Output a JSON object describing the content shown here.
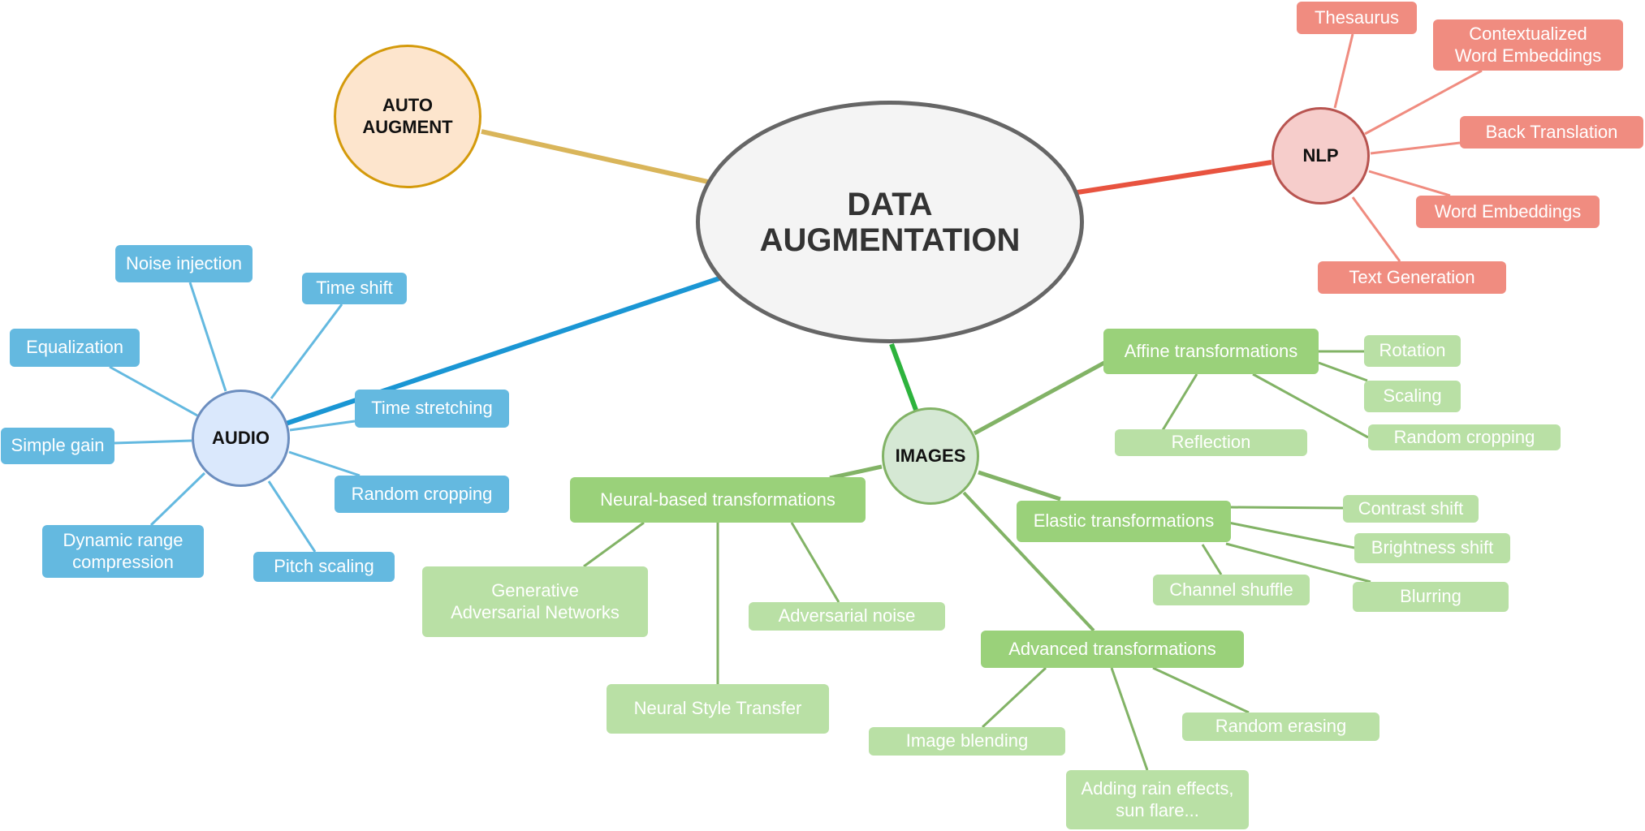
{
  "diagram": {
    "type": "mind-map",
    "title": "DATA\nAUGMENTATION",
    "colors": {
      "auto_augment": "#d9b55a",
      "nlp": "#e8533f",
      "audio": "#1a96d4",
      "images": "#2db33d",
      "audio_leaf": "#64b9e0",
      "nlp_leaf": "#f08c80",
      "images_mid": "#9ad17a",
      "images_leaf": "#b9e0a5"
    },
    "branches": {
      "auto_augment": {
        "label": "AUTO\nAUGMENT"
      },
      "nlp": {
        "label": "NLP",
        "children": [
          "Thesaurus",
          "Contextualized\nWord Embeddings",
          "Back Translation",
          "Word Embeddings",
          "Text Generation"
        ]
      },
      "audio": {
        "label": "AUDIO",
        "children": [
          "Noise injection",
          "Time shift",
          "Equalization",
          "Time stretching",
          "Simple gain",
          "Random cropping",
          "Dynamic range\ncompression",
          "Pitch scaling"
        ]
      },
      "images": {
        "label": "IMAGES",
        "groups": {
          "affine": {
            "label": "Affine transformations",
            "children": [
              "Rotation",
              "Scaling",
              "Random cropping",
              "Reflection"
            ]
          },
          "elastic": {
            "label": "Elastic transformations",
            "children": [
              "Contrast shift",
              "Brightness shift",
              "Blurring",
              "Channel shuffle"
            ]
          },
          "neural": {
            "label": "Neural-based transformations",
            "children": [
              "Generative\nAdversarial Networks",
              "Neural Style Transfer",
              "Adversarial noise"
            ]
          },
          "advanced": {
            "label": "Advanced transformations",
            "children": [
              "Image blending",
              "Adding rain effects,\nsun flare...",
              "Random erasing"
            ]
          }
        }
      }
    }
  }
}
